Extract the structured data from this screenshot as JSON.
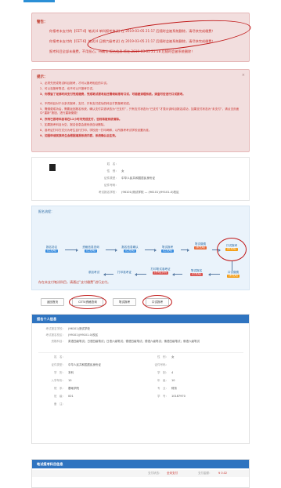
{
  "warning": {
    "title": "警告：",
    "lines": [
      "你报考未支付的【CET-4】笔试(4 单科报考笔试) 在 2019-03-05 21:17 后随时会被系统删除，请尽快完成缴费！",
      "你报考未支付的【CET-6】笔试(4 日期六级考试) 在 2019-03-05 21:17 后随时会被系统删除，请尽快完成缴费！",
      "报考科目全部未缴费，不用担心，待确认 报名信息 将在 2019-03-05 21:18 后随时会被系统删除！"
    ]
  },
  "tips": {
    "title": "提示：",
    "close": "×",
    "items": [
      "1、必须先完成笔试科目报考，才可以报考相应的口试。",
      "2、可以没报考笔试，也不可以只报考口试。",
      "3、你预留了足够时间支付完成缴费，完成笔试报考后还需继续报考口试，可能被清理系统。清查可否进行口试报考。",
      "4、不同科目对于分多次报考，支付，只有支付成功的科目才算报考完成。",
      "5、需缴费成功后，需要返回报名系统，确认支付并查状态为“已支付”，只有支付状态为“已支付”才表示该科目报名成功，如果支付状态为“未支付”，请点击页面中“重新”按钮，进行重新缴费！",
      "6、所有已报考科目将在12小时内完成支付，否则将被系统清除。",
      "7、如果报考科目为空，报名信息会被系统自动删除。",
      "8、准考证打印方式分为考生自行打印、学校统一打印两种，以所报考考试学校设置为准。",
      "9、如因申请民族考生会根据填报系统内容，系统确认后生效。"
    ]
  },
  "candidate": {
    "rows": [
      {
        "label": "姓　名：",
        "value": ""
      },
      {
        "label": "性　别：",
        "value": "女"
      },
      {
        "label": "证件类型：",
        "value": "中华人民共和国居民身份证"
      },
      {
        "label": "证件号码：",
        "value": ""
      },
      {
        "label": "考试报名学校：",
        "value": "(96101)测试学校 — (96101)(99101-0)校区"
      }
    ]
  },
  "flow": {
    "title": "报名流程：",
    "top_nodes": [
      {
        "label": "报名协议",
        "status": "(已完成)"
      },
      {
        "label": "资格信息查询",
        "status": "(已完成)"
      },
      {
        "label": "报名信息确认",
        "status": "(已完成)"
      },
      {
        "label": "笔试报考",
        "status": "(已完成)"
      },
      {
        "label": "笔试缴费",
        "status": "(未完成)"
      },
      {
        "label": "口试报考",
        "status": "(选)"
      }
    ],
    "right_status": "(未完成)",
    "bottom_nodes": [
      {
        "label": "参加考试",
        "status": ""
      },
      {
        "label": "打印准考证",
        "status": ""
      },
      {
        "label": "打印笔试准考证",
        "status": "(不可打印)"
      },
      {
        "label": "笔试报名",
        "status": "(已完成)"
      },
      {
        "label": "口试缴费",
        "status": "(未完成)"
      }
    ],
    "note": "存在未支付笔试科目，请通过“支付缴费”进行支付。"
  },
  "buttons": [
    {
      "label": "返回首页"
    },
    {
      "label": "CET4资格查询"
    },
    {
      "label": "笔试报考"
    },
    {
      "label": "口试报考"
    }
  ],
  "personal": {
    "header": "报名个人信息",
    "school_rows": [
      {
        "label": "考试报名学校：",
        "value": "(96101)测试学校"
      },
      {
        "label": "考试报名校区：",
        "value": "(99101)(99101-0)校区"
      },
      {
        "label": "资格科目：",
        "value": "英语四级笔试；日语四级笔试；日语六级笔试；德语四级笔试；德语六级笔试；俄语四级笔试；俄语六级笔试"
      }
    ],
    "left_rows": [
      {
        "label": "姓　名：",
        "value": ""
      },
      {
        "label": "证件类型：",
        "value": "中华人民共和国居民身份证"
      },
      {
        "label": "学　历：",
        "value": "本科"
      },
      {
        "label": "入学年份：",
        "value": "10"
      },
      {
        "label": "院　系：",
        "value": "基础学院"
      },
      {
        "label": "班　级：",
        "value": "001"
      },
      {
        "label": "备　注：",
        "value": ""
      }
    ],
    "right_rows": [
      {
        "label": "性　别：",
        "value": "女"
      },
      {
        "label": "证件号码：",
        "value": ""
      },
      {
        "label": "学　制：",
        "value": "4"
      },
      {
        "label": "年　级：",
        "value": "10"
      },
      {
        "label": "专　业：",
        "value": "财务"
      },
      {
        "label": "学　号：",
        "value": "10187970"
      }
    ]
  },
  "pay": {
    "header": "笔试报考科目信息",
    "status_label": "支付状态：",
    "status_value": "全未支付",
    "amount_label": "支付金额：",
    "amount_value": "¥ 0.02"
  },
  "colors": {
    "primary": "#2f74c0",
    "danger": "#c9302c",
    "warning_bg": "#f2dede",
    "done_tag": "#3a8ee0",
    "todo_tag": "#e96b3a"
  }
}
